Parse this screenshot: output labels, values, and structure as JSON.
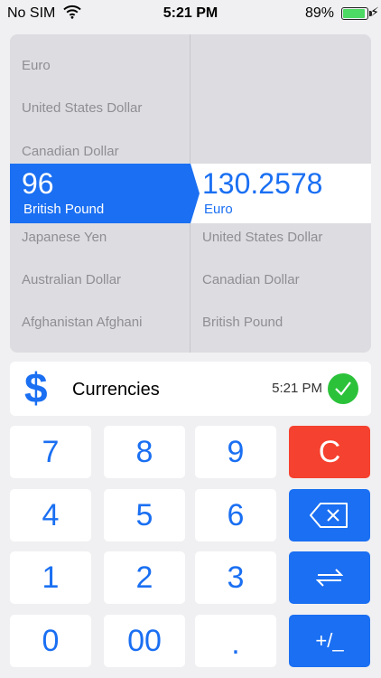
{
  "status_bar": {
    "carrier": "No SIM",
    "time": "5:21 PM",
    "battery_percent": "89%",
    "battery_level": 0.89
  },
  "picker": {
    "left": {
      "above": [
        "Euro",
        "United States Dollar",
        "Canadian Dollar"
      ],
      "selected_value": "96",
      "selected_name": "British Pound",
      "below": [
        "Japanese Yen",
        "Australian Dollar",
        "Afghanistan Afghani"
      ]
    },
    "right": {
      "above": [
        "",
        "",
        ""
      ],
      "selected_value": "130.2578",
      "selected_name": "Euro",
      "below": [
        "United States Dollar",
        "Canadian Dollar",
        "British Pound"
      ]
    }
  },
  "info": {
    "icon_symbol": "$",
    "title": "Currencies",
    "updated_time": "5:21 PM",
    "status_icon": "check-circle-icon"
  },
  "keypad": {
    "keys": [
      [
        "7",
        "8",
        "9",
        "C"
      ],
      [
        "4",
        "5",
        "6",
        "backspace"
      ],
      [
        "1",
        "2",
        "3",
        "swap"
      ],
      [
        "0",
        "00",
        ".",
        "+/_"
      ]
    ]
  },
  "colors": {
    "accent": "#1a6ff2",
    "clear": "#f5412f",
    "success": "#2bc23a",
    "panel": "#dddde1",
    "background": "#f0f0f2"
  }
}
